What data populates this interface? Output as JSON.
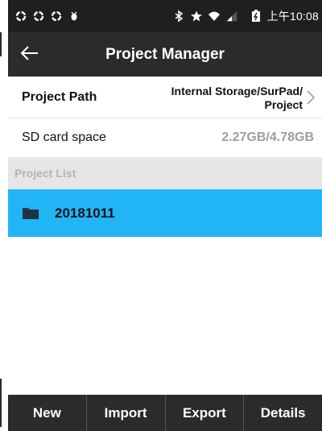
{
  "status_bar": {
    "time": "上午10:08",
    "icons": [
      "sync-icon",
      "sync-icon",
      "sync-icon",
      "debug-icon",
      "bluetooth-icon",
      "star-icon",
      "wifi-icon",
      "signal-icon",
      "battery-icon"
    ]
  },
  "header": {
    "title": "Project Manager",
    "back_icon": "back-arrow-icon"
  },
  "settings": {
    "project_path_label": "Project Path",
    "project_path_value_line1": "Internal Storage/SurPad/",
    "project_path_value_line2": "Project",
    "sd_label": "SD card space",
    "sd_value": "2.27GB/4.78GB"
  },
  "project_list": {
    "header": "Project List",
    "items": [
      {
        "name": "20181011",
        "selected": true,
        "icon": "folder-icon"
      }
    ]
  },
  "bottom_bar": {
    "new_label": "New",
    "import_label": "Import",
    "export_label": "Export",
    "details_label": "Details"
  },
  "colors": {
    "status_bar_bg": "#1f1f1f",
    "action_bar_bg": "#2b2b2b",
    "selected_item_bg": "#21b5f6",
    "section_header_bg": "#e6e6e6",
    "muted_text": "#9e9e9e"
  }
}
